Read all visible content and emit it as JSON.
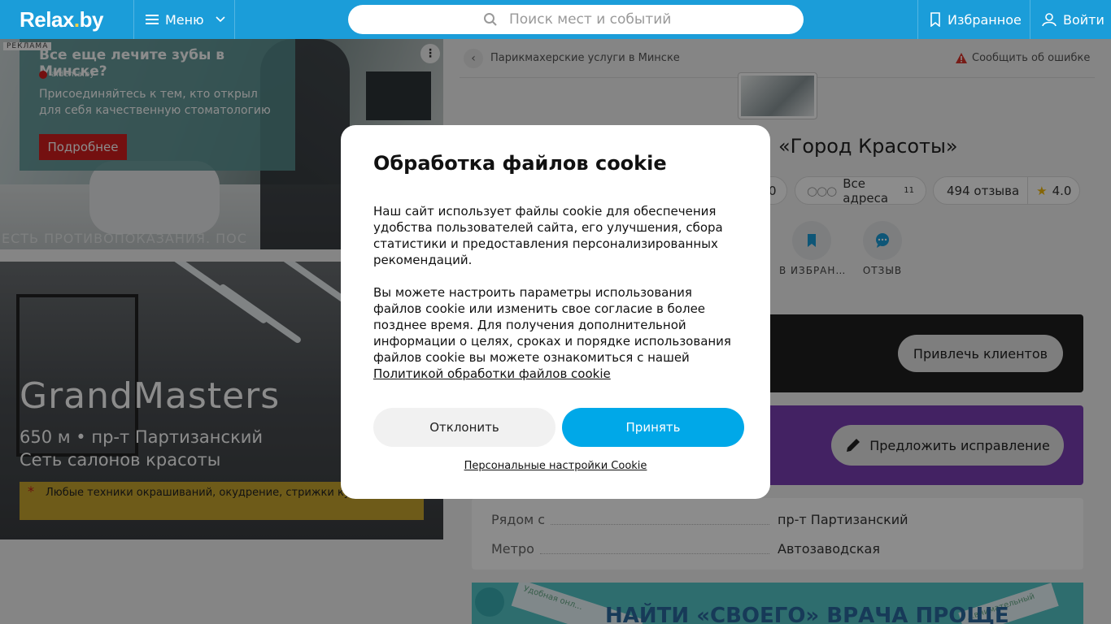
{
  "header": {
    "logo_main": "Relax",
    "logo_dot": ".",
    "logo_suffix": "by",
    "menu_label": "Меню",
    "search_placeholder": "Поиск мест и событий",
    "favorites_label": "Избранное",
    "login_label": "Войти",
    "accent": "#1b9dd9"
  },
  "ad": {
    "label": "РЕКЛАМА",
    "title": "Все еще лечите зубы в Минске?",
    "source": "aldenta.by",
    "description": "Присоединяйтесь к тем, кто открыл для себя качественную стоматологию",
    "cta": "Подробнее",
    "more_icon": "⋮",
    "warning": "ЕСТЬ ПРОТИВОПОКАЗАНИЯ. ПОС"
  },
  "hero": {
    "name": "GrandMasters",
    "meta": "650 м • пр-т Партизанский",
    "type": "Сеть салонов красоты",
    "note": "Любые техники окрашиваний, окудрение, стрижки ку... методом"
  },
  "breadcrumb": {
    "text": "Парикмахерские услуги в Минске",
    "report": "Сообщить об ошибке"
  },
  "salon": {
    "title": "«Город Красоты»",
    "frag_pill": "0",
    "addresses_label": "Все адреса",
    "addresses_count": "11",
    "reviews_label": "494 отзыва",
    "rating": "4.0"
  },
  "actions": {
    "favorite": "В ИЗБРАН…",
    "review": "ОТЗЫВ"
  },
  "cards": {
    "attract": "Привлечь клиентов",
    "suggest": "Предложить исправление"
  },
  "info": [
    {
      "key": "Рядом с",
      "value": "пр-т Партизанский"
    },
    {
      "key": "Метро",
      "value": "Автозаводская"
    }
  ],
  "banner": {
    "text": "НАЙТИ «СВОЕГО» ВРАЧА ПРОЩЕ",
    "ribbon_left": "Удобная онл...",
    "ribbon_right": "...внимательный"
  },
  "cookie": {
    "title": "Обработка файлов cookie",
    "paragraph1": "Наш сайт использует файлы cookie для обеспечения удобства пользователей сайта, его улучшения, сбора статистики и предоставления персонализированных рекомендаций.",
    "paragraph2": "Вы можете настроить параметры использования файлов cookie или изменить свое согласие в более позднее время. Для получения дополнительной информации о целях, сроках и порядке использования файлов cookie вы можете ознакомиться с нашей",
    "policy_link": "Политикой обработки файлов cookie",
    "decline": "Отклонить",
    "accept": "Принять",
    "settings": "Персональные настройки Cookie",
    "accept_color": "#00a8e8"
  }
}
